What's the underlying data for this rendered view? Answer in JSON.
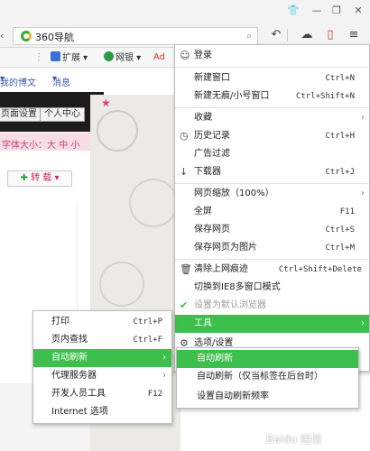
{
  "browser": {
    "address": "360导航",
    "favorites": [
      {
        "label": "扩展",
        "icon": "puzzle-icon",
        "color": "#3b6fd1"
      },
      {
        "label": "网银",
        "icon": "bank-icon",
        "color": "#2f9a45"
      },
      {
        "label": "Ad",
        "icon": "ad-icon",
        "color": "#d43b2c"
      }
    ]
  },
  "blog": {
    "nav": [
      "我的博文",
      "消息"
    ],
    "header_buttons": [
      "页面设置",
      "个人中心"
    ],
    "font_size_label": "字体大小：",
    "font_sizes": [
      "大",
      "中",
      "小"
    ],
    "repost_button": "转 载"
  },
  "main_menu": {
    "items": [
      {
        "label": "登录",
        "icon": "user-icon"
      },
      {
        "label": "新建窗口",
        "shortcut": "Ctrl+N"
      },
      {
        "label": "新建无痕/小号窗口",
        "shortcut": "Ctrl+Shift+N"
      },
      {
        "label": "收藏",
        "submenu": true
      },
      {
        "label": "历史记录",
        "shortcut": "Ctrl+H",
        "icon": "history-icon"
      },
      {
        "label": "广告过滤"
      },
      {
        "label": "下载器",
        "shortcut": "Ctrl+J",
        "icon": "download-icon"
      },
      {
        "label": "网页缩放（100%）",
        "submenu": true
      },
      {
        "label": "全屏",
        "shortcut": "F11"
      },
      {
        "label": "保存网页",
        "shortcut": "Ctrl+S"
      },
      {
        "label": "保存网页为图片",
        "shortcut": "Ctrl+M"
      },
      {
        "label": "清除上网痕迹",
        "shortcut": "Ctrl+Shift+Delete",
        "icon": "trash-icon"
      },
      {
        "label": "切换到IE8多窗口模式"
      },
      {
        "label": "设置为默认浏览器",
        "icon": "check-icon",
        "disabled": true
      },
      {
        "label": "工具",
        "submenu": true,
        "highlighted": true
      },
      {
        "label": "选项/设置",
        "icon": "gear-icon"
      }
    ]
  },
  "auto_refresh_menu": {
    "items": [
      {
        "label": "自动刷新",
        "highlighted": true
      },
      {
        "label": "自动刷新（仅当标签在后台时）"
      },
      {
        "label": "设置自动刷新频率"
      }
    ]
  },
  "tools_menu": {
    "items": [
      {
        "label": "打印",
        "shortcut": "Ctrl+P"
      },
      {
        "label": "页内查找",
        "shortcut": "Ctrl+F"
      },
      {
        "label": "自动刷新",
        "submenu": true,
        "highlighted": true
      },
      {
        "label": "代理服务器",
        "submenu": true
      },
      {
        "label": "开发人员工具",
        "shortcut": "F12"
      },
      {
        "label": "Internet 选项"
      }
    ]
  },
  "watermark": "Baidu 经验",
  "colors": {
    "highlight": "#3cbf4c",
    "accent_pink": "#c8285f"
  }
}
